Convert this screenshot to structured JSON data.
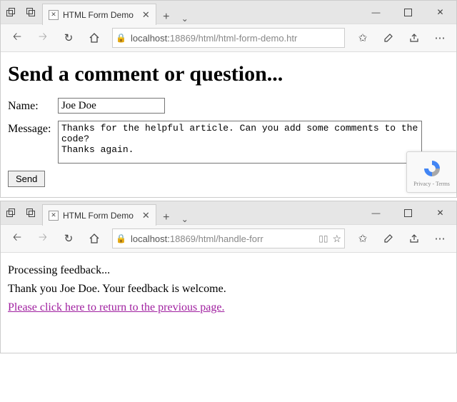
{
  "window1": {
    "tab_title": "HTML Form Demo",
    "address_host": "localhost:",
    "address_path": "18869/html/html-form-demo.htr"
  },
  "form": {
    "heading": "Send a comment or question...",
    "name_label": "Name:",
    "name_value": "Joe Doe",
    "message_label": "Message:",
    "message_value": "Thanks for the helpful article. Can you add some comments to the code?\nThanks again.",
    "send_label": "Send",
    "recaptcha_text": "Privacy - Terms"
  },
  "window2": {
    "tab_title": "HTML Form Demo",
    "address_host": "localhost:",
    "address_path": "18869/html/handle-forr"
  },
  "result": {
    "processing": "Processing feedback...",
    "thanks": "Thank you Joe Doe. Your feedback is welcome.",
    "return_link": "Please click here to return to the previous page."
  }
}
